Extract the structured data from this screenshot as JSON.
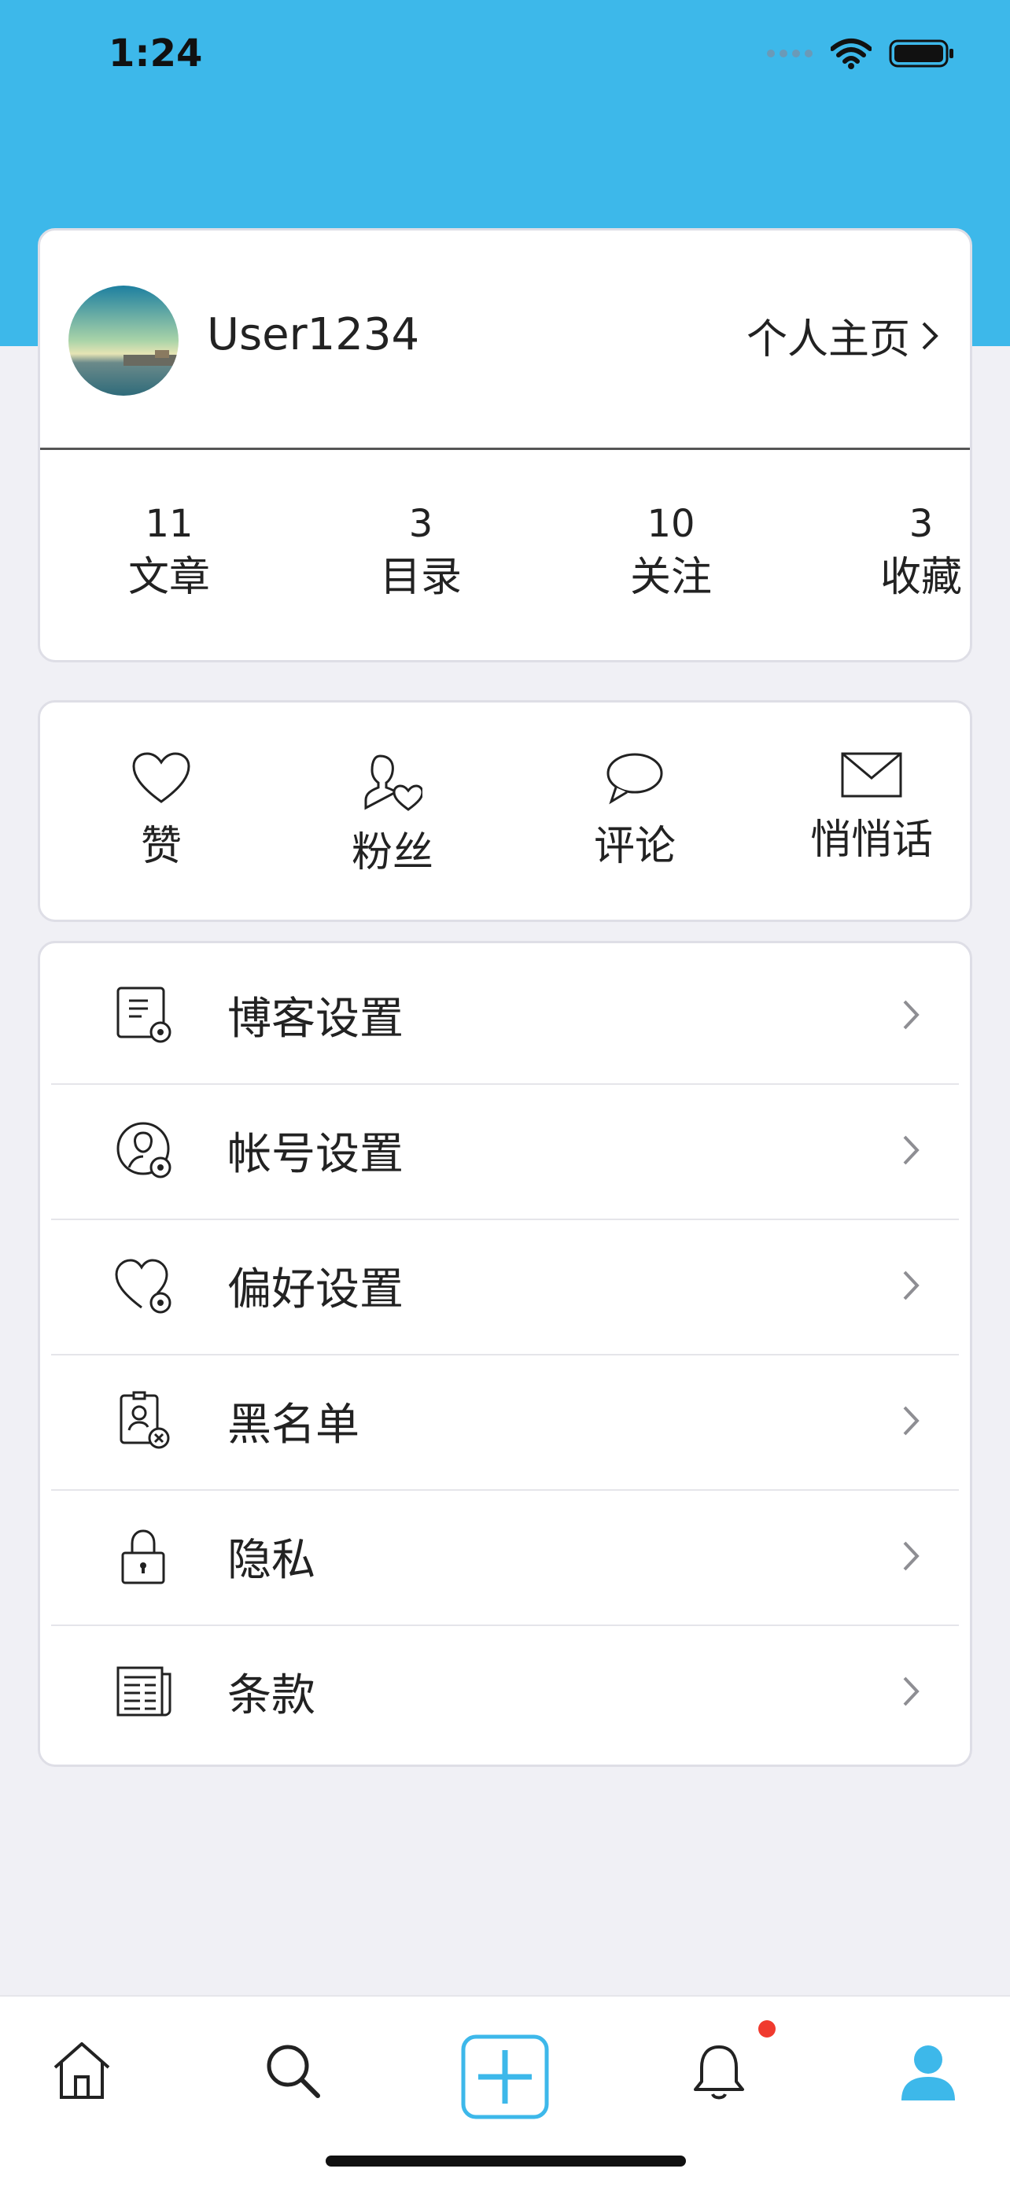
{
  "status_bar": {
    "time": "1:24"
  },
  "profile": {
    "username": "User1234",
    "homepage_link": "个人主页",
    "stats": [
      {
        "value": "11",
        "label": "文章"
      },
      {
        "value": "3",
        "label": "目录"
      },
      {
        "value": "10",
        "label": "关注"
      },
      {
        "value": "3",
        "label": "收藏"
      }
    ]
  },
  "quick_actions": [
    {
      "label": "赞",
      "icon": "heart-icon"
    },
    {
      "label": "粉丝",
      "icon": "follower-icon"
    },
    {
      "label": "评论",
      "icon": "comment-icon"
    },
    {
      "label": "悄悄话",
      "icon": "mail-icon"
    }
  ],
  "menu": [
    {
      "label": "博客设置",
      "icon": "blog-settings-icon"
    },
    {
      "label": "帐号设置",
      "icon": "account-settings-icon"
    },
    {
      "label": "偏好设置",
      "icon": "preference-settings-icon"
    },
    {
      "label": "黑名单",
      "icon": "blacklist-icon"
    },
    {
      "label": "隐私",
      "icon": "lock-icon"
    },
    {
      "label": "条款",
      "icon": "terms-icon"
    }
  ],
  "tab_bar": {
    "tabs": [
      "home-icon",
      "search-icon",
      "add-icon",
      "bell-icon",
      "profile-icon"
    ],
    "active": "profile-icon",
    "accent_color": "#3db8ea",
    "badge_color": "#f03a2e"
  }
}
